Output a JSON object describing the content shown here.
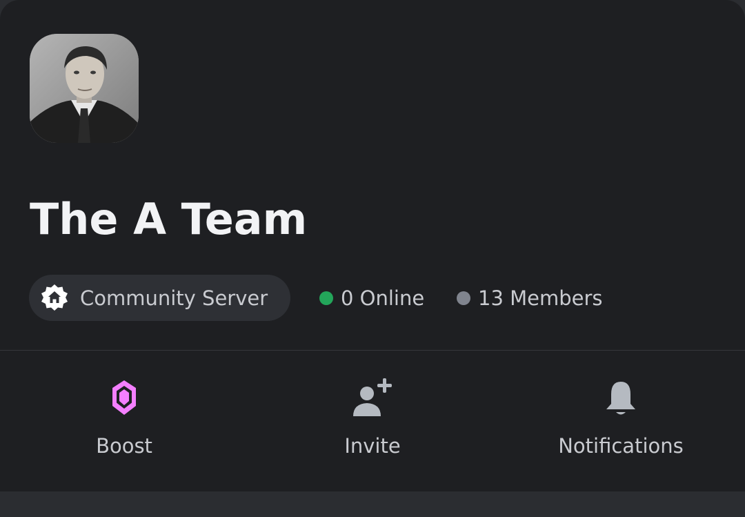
{
  "server": {
    "name": "The A Team",
    "type_label": "Community Server",
    "online": "0 Online",
    "members": "13 Members"
  },
  "colors": {
    "online_dot": "#23a55a",
    "members_dot": "#80848e",
    "boost_accent": "#f47fff"
  },
  "actions": [
    {
      "label": "Boost",
      "icon": "boost-gem-icon"
    },
    {
      "label": "Invite",
      "icon": "add-user-icon"
    },
    {
      "label": "Notifications",
      "icon": "bell-icon"
    }
  ]
}
